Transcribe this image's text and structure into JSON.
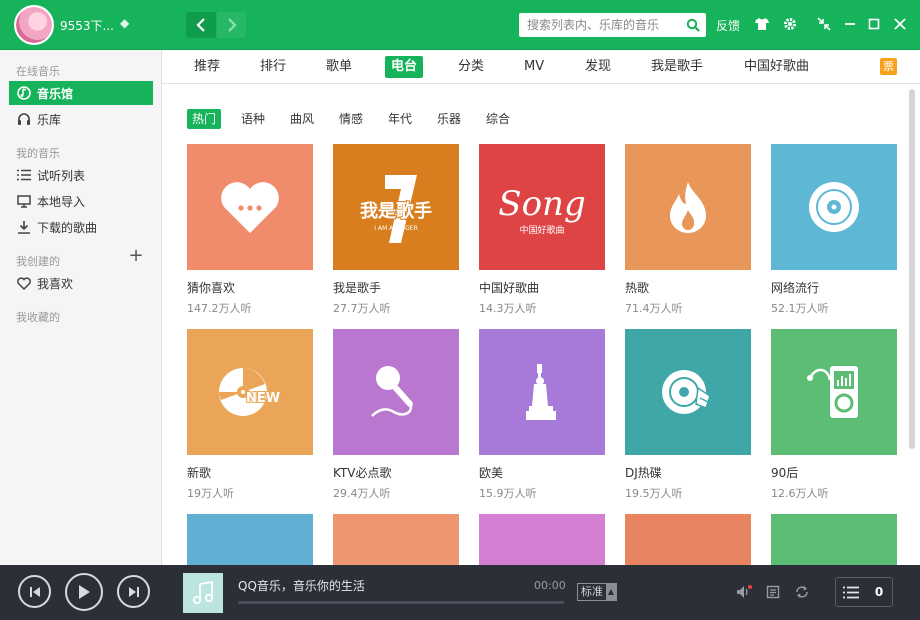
{
  "header": {
    "username": "9553下...",
    "search_placeholder": "搜索列表内、乐库的音乐",
    "feedback": "反馈"
  },
  "sidebar": {
    "section_online": "在线音乐",
    "item_music_hall": "音乐馆",
    "item_library": "乐库",
    "section_my_music": "我的音乐",
    "item_trial_list": "试听列表",
    "item_local_import": "本地导入",
    "item_downloaded": "下载的歌曲",
    "section_created": "我创建的",
    "item_favorites": "我喜欢",
    "section_collected": "我收藏的"
  },
  "tabs": [
    "推荐",
    "排行",
    "歌单",
    "电台",
    "分类",
    "MV",
    "发现",
    "我是歌手",
    "中国好歌曲"
  ],
  "ticket_label": "票",
  "subtabs": [
    "热门",
    "语种",
    "曲风",
    "情感",
    "年代",
    "乐器",
    "综合"
  ],
  "cards": [
    {
      "title": "猜你喜欢",
      "listeners": "147.2万人听",
      "color": "#f08c6c",
      "icon": "heart-icon"
    },
    {
      "title": "我是歌手",
      "listeners": "27.7万人听",
      "color": "#d97e1f",
      "icon": "i-am-singer-logo",
      "logo_text": "我是歌手",
      "logo_sub": "I AM A SINGER"
    },
    {
      "title": "中国好歌曲",
      "listeners": "14.3万人听",
      "color": "#de4444",
      "icon": "sing-my-song-logo",
      "logo_text": "Song",
      "logo_sub": "中国好歌曲"
    },
    {
      "title": "热歌",
      "listeners": "71.4万人听",
      "color": "#e8965a",
      "icon": "flame-icon"
    },
    {
      "title": "网络流行",
      "listeners": "52.1万人听",
      "color": "#5fb7d6",
      "icon": "vinyl-icon"
    },
    {
      "title": "新歌",
      "listeners": "19万人听",
      "color": "#eaa559",
      "icon": "new-disc-icon",
      "badge": "NEW"
    },
    {
      "title": "KTV必点歌",
      "listeners": "29.4万人听",
      "color": "#b977cf",
      "icon": "microphone-icon"
    },
    {
      "title": "欧美",
      "listeners": "15.9万人听",
      "color": "#a77ad9",
      "icon": "statue-of-liberty-icon"
    },
    {
      "title": "DJ热碟",
      "listeners": "19.5万人听",
      "color": "#3fa7a7",
      "icon": "dj-disc-icon"
    },
    {
      "title": "90后",
      "listeners": "12.6万人听",
      "color": "#5cbd75",
      "icon": "mp3-player-icon"
    },
    {
      "title": "",
      "listeners": "",
      "color": "#5fb0d3",
      "icon": ""
    },
    {
      "title": "",
      "listeners": "",
      "color": "#ed9670",
      "icon": ""
    },
    {
      "title": "",
      "listeners": "",
      "color": "#d57fd3",
      "icon": ""
    },
    {
      "title": "",
      "listeners": "",
      "color": "#e8845f",
      "icon": ""
    },
    {
      "title": "",
      "listeners": "",
      "color": "#5cbd75",
      "icon": ""
    }
  ],
  "player": {
    "track_title": "QQ音乐，音乐你的生活",
    "time": "00:00",
    "quality": "标准",
    "queue_count": "0",
    "progress": 0
  },
  "colors": {
    "brand": "#16b35a",
    "player_bg": "#2c2f38"
  }
}
